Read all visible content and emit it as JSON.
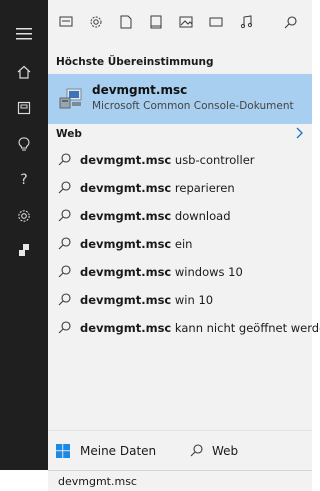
{
  "toolbar": {
    "icons": [
      "app-list-icon",
      "settings-icon",
      "document-icon",
      "file-icon",
      "image-icon",
      "video-icon",
      "music-icon",
      "search-icon"
    ]
  },
  "rail": {
    "icons": [
      "hamburger-icon",
      "home-icon",
      "notebook-icon",
      "lightbulb-icon",
      "help-icon",
      "settings-icon",
      "user-icon"
    ]
  },
  "best_match": {
    "heading": "Höchste Übereinstimmung",
    "title": "devmgmt.msc",
    "subtitle": "Microsoft Common Console-Dokument",
    "highlight_color": "#a8cfef"
  },
  "web": {
    "heading": "Web",
    "suggestions": [
      {
        "bold": "devmgmt.msc",
        "rest": " usb-controller"
      },
      {
        "bold": "devmgmt.msc",
        "rest": " reparieren"
      },
      {
        "bold": "devmgmt.msc",
        "rest": " download"
      },
      {
        "bold": "devmgmt.msc",
        "rest": " ein"
      },
      {
        "bold": "devmgmt.msc",
        "rest": " windows 10"
      },
      {
        "bold": "devmgmt.msc",
        "rest": " win 10"
      },
      {
        "bold": "devmgmt.msc",
        "rest": " kann nicht geöffnet werden"
      }
    ]
  },
  "bottom_tabs": {
    "my_data": "Meine Daten",
    "web": "Web"
  },
  "search": {
    "value": "devmgmt.msc"
  }
}
